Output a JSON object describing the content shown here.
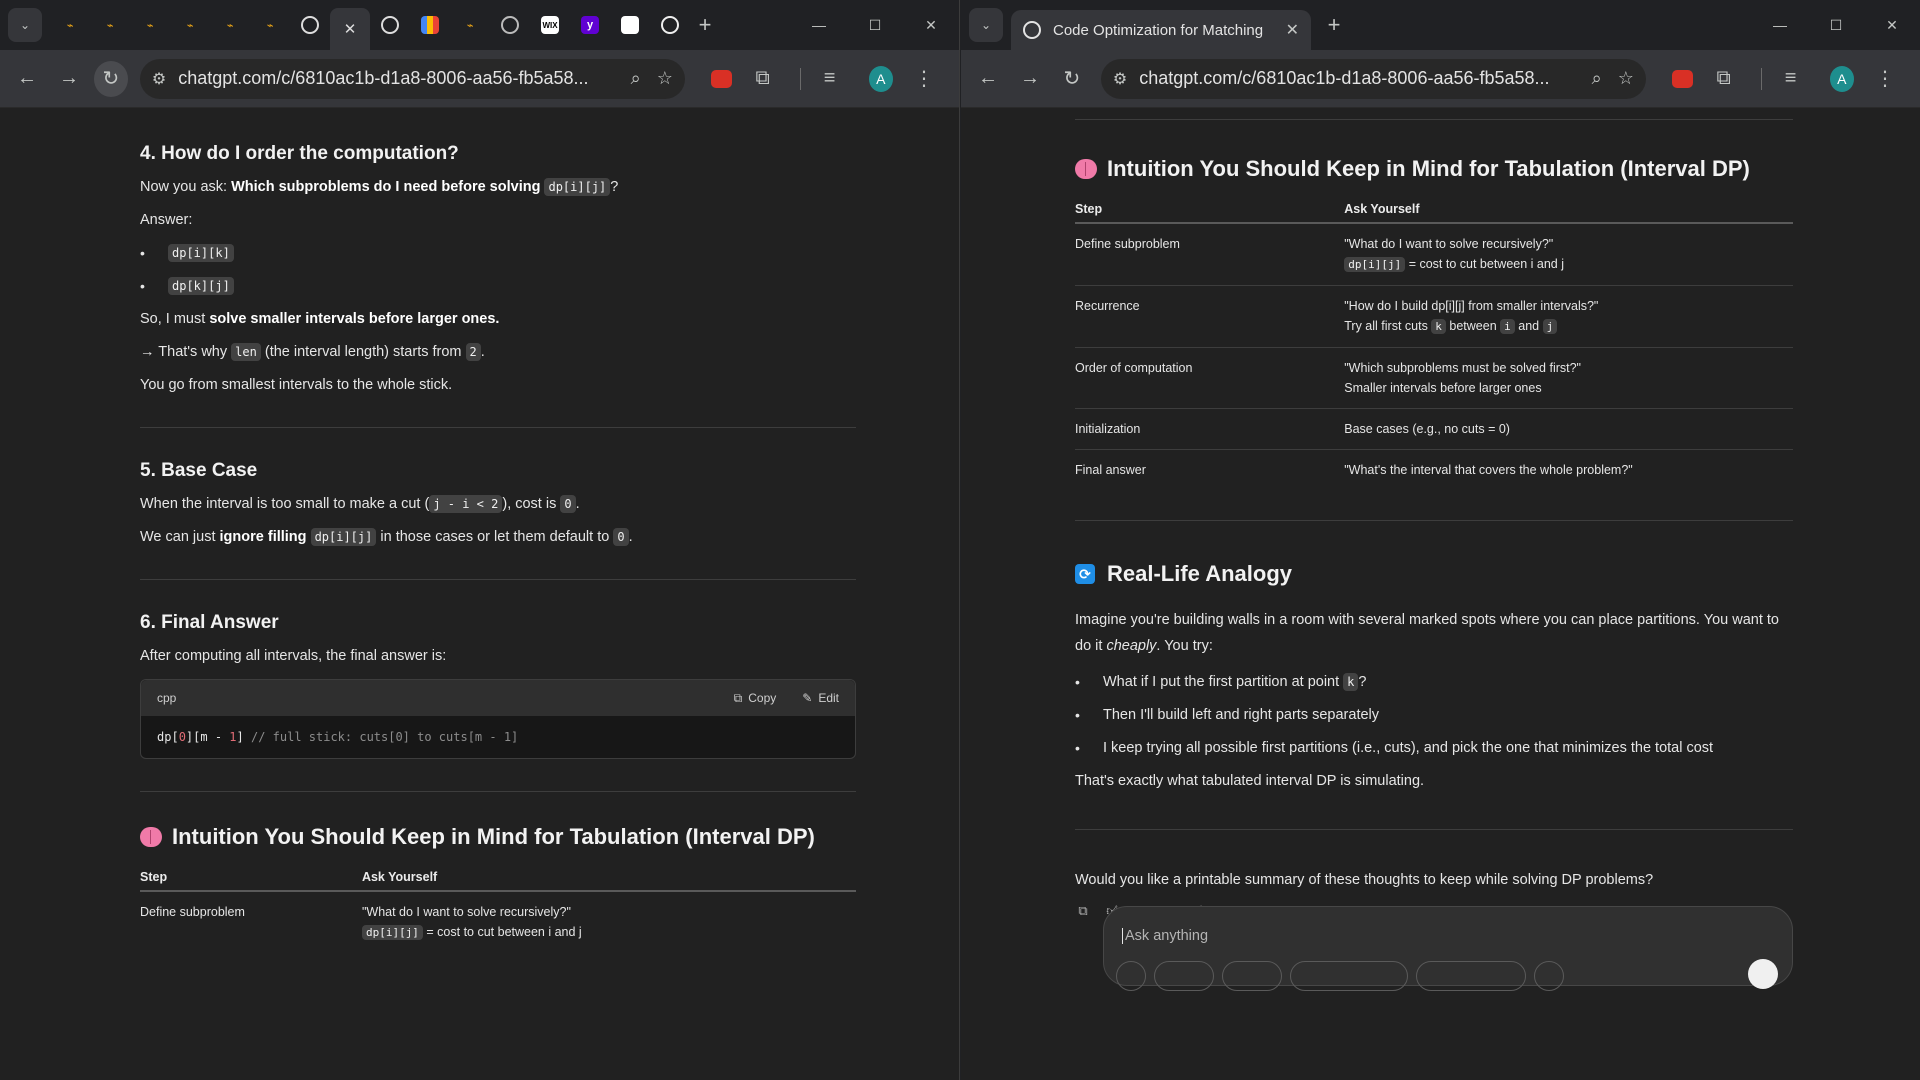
{
  "left_window": {
    "url": "chatgpt.com/c/6810ac1b-d1a8-8006-aa56-fb5a58...",
    "section4": {
      "heading": "4. How do I order the computation?",
      "p1_pre": "Now you ask: ",
      "p1_bold": "Which subproblems do I need before solving",
      "p1_code": "dp[i][j]",
      "p1_post": "?",
      "answer_label": "Answer:",
      "bullets": [
        "dp[i][k]",
        "dp[k][j]"
      ],
      "p2_pre": "So, I must ",
      "p2_bold": "solve smaller intervals before larger ones.",
      "p3_pre": "→ That's why ",
      "p3_code1": "len",
      "p3_mid": " (the interval length) starts from ",
      "p3_code2": "2",
      "p3_post": ".",
      "p4": "You go from smallest intervals to the whole stick."
    },
    "section5": {
      "heading": "5. Base Case",
      "p1_pre": "When the interval is too small to make a cut (",
      "p1_code1": "j - i < 2",
      "p1_mid": "), cost is ",
      "p1_code2": "0",
      "p1_post": ".",
      "p2_pre": "We can just ",
      "p2_bold": "ignore filling",
      "p2_code1": "dp[i][j]",
      "p2_mid": " in those cases or let them default to ",
      "p2_code2": "0",
      "p2_post": "."
    },
    "section6": {
      "heading": "6. Final Answer",
      "p1": "After computing all intervals, the final answer is:",
      "code_lang": "cpp",
      "copy_label": "Copy",
      "edit_label": "Edit",
      "code_a": "dp[",
      "code_b": "0",
      "code_c": "][m - ",
      "code_d": "1",
      "code_e": "] ",
      "code_comment": "// full stick: cuts[0] to cuts[m - 1]"
    },
    "intuition": {
      "heading": "Intuition You Should Keep in Mind for Tabulation (Interval DP)",
      "col_step": "Step",
      "col_ask": "Ask Yourself",
      "row1_step": "Define subproblem",
      "row1_line1": "\"What do I want to solve recursively?\"",
      "row1_code": "dp[i][j]",
      "row1_line2": " = cost to cut between i and j"
    }
  },
  "right_window": {
    "tab_title": "Code Optimization for Matching",
    "url": "chatgpt.com/c/6810ac1b-d1a8-8006-aa56-fb5a58...",
    "intuition": {
      "heading": "Intuition You Should Keep in Mind for Tabulation (Interval DP)",
      "col_step": "Step",
      "col_ask": "Ask Yourself",
      "rows": {
        "r1_step": "Define subproblem",
        "r1_line1": "\"What do I want to solve recursively?\"",
        "r1_code": "dp[i][j]",
        "r1_line2": " = cost to cut between i and j",
        "r2_step": "Recurrence",
        "r2_line1": "\"How do I build dp[i][j] from smaller intervals?\"",
        "r2_pre": "Try all first cuts ",
        "r2_code1": "k",
        "r2_mid1": " between ",
        "r2_code2": "i",
        "r2_mid2": " and ",
        "r2_code3": "j",
        "r3_step": "Order of computation",
        "r3_line1": "\"Which subproblems must be solved first?\"",
        "r3_line2": "Smaller intervals before larger ones",
        "r4_step": "Initialization",
        "r4_line1": "Base cases (e.g., no cuts = 0)",
        "r5_step": "Final answer",
        "r5_line1": "\"What's the interval that covers the whole problem?\""
      }
    },
    "analogy": {
      "heading": "Real-Life Analogy",
      "p1_pre": "Imagine you're building walls in a room with several marked spots where you can place partitions. You want to do it ",
      "p1_em": "cheaply",
      "p1_post": ". You try:",
      "b1_pre": "What if I put the first partition at point ",
      "b1_code": "k",
      "b1_post": "?",
      "b2": "Then I'll build left and right parts separately",
      "b3": "I keep trying all possible first partitions (i.e., cuts), and pick the one that minimizes the total cost",
      "p2": "That's exactly what tabulated interval DP is simulating."
    },
    "followup": "Would you like a printable summary of these thoughts to keep while solving DP problems?",
    "ask_placeholder": "Ask anything"
  }
}
